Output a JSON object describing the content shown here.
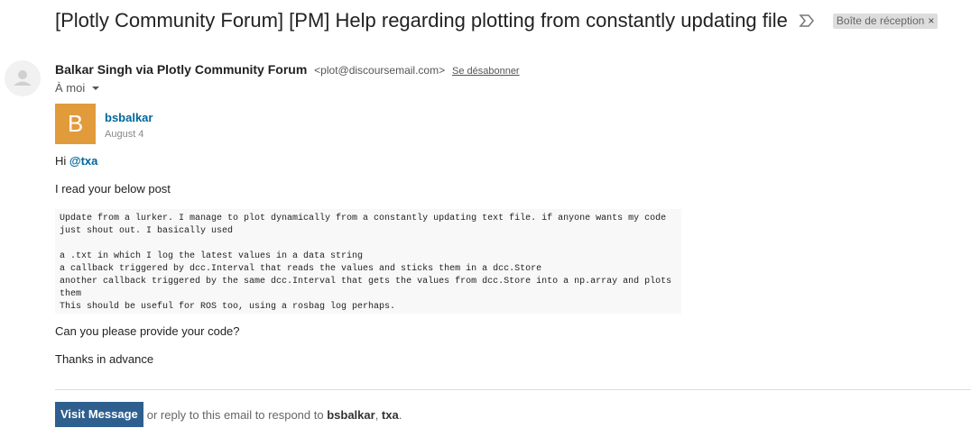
{
  "subject": "[Plotly Community Forum] [PM] Help regarding plotting from constantly updating file",
  "label": {
    "text": "Boîte de réception",
    "remove": "×"
  },
  "sender": {
    "name": "Balkar Singh via Plotly Community Forum",
    "email": "<plot@discoursemail.com>",
    "unsubscribe": "Se désabonner"
  },
  "recipient": "À moi",
  "post": {
    "avatar_letter": "B",
    "avatar_color": "#e29b3a",
    "username": "bsbalkar",
    "date": "August 4"
  },
  "body": {
    "greeting": "Hi ",
    "mention": "@txa",
    "line1": "I read your below post",
    "code": "Update from a lurker. I manage to plot dynamically from a constantly updating text file. if anyone wants my code just shout out. I basically used\n\na .txt in which I log the latest values in a data string\na callback triggered by dcc.Interval that reads the values and sticks them in a dcc.Store\nanother callback triggered by the same dcc.Interval that gets the values from dcc.Store into a np.array and plots them\nThis should be useful for ROS too, using a rosbag log perhaps.",
    "line2": "Can you please provide your code?",
    "line3": "Thanks in advance"
  },
  "footer": {
    "button": "Visit Message",
    "text_before": "or reply to this email to respond to ",
    "name1": "bsbalkar",
    "separator": ", ",
    "name2": "txa",
    "end": "."
  },
  "colors": {
    "link": "#006699",
    "button_bg": "#2f5f8f"
  }
}
